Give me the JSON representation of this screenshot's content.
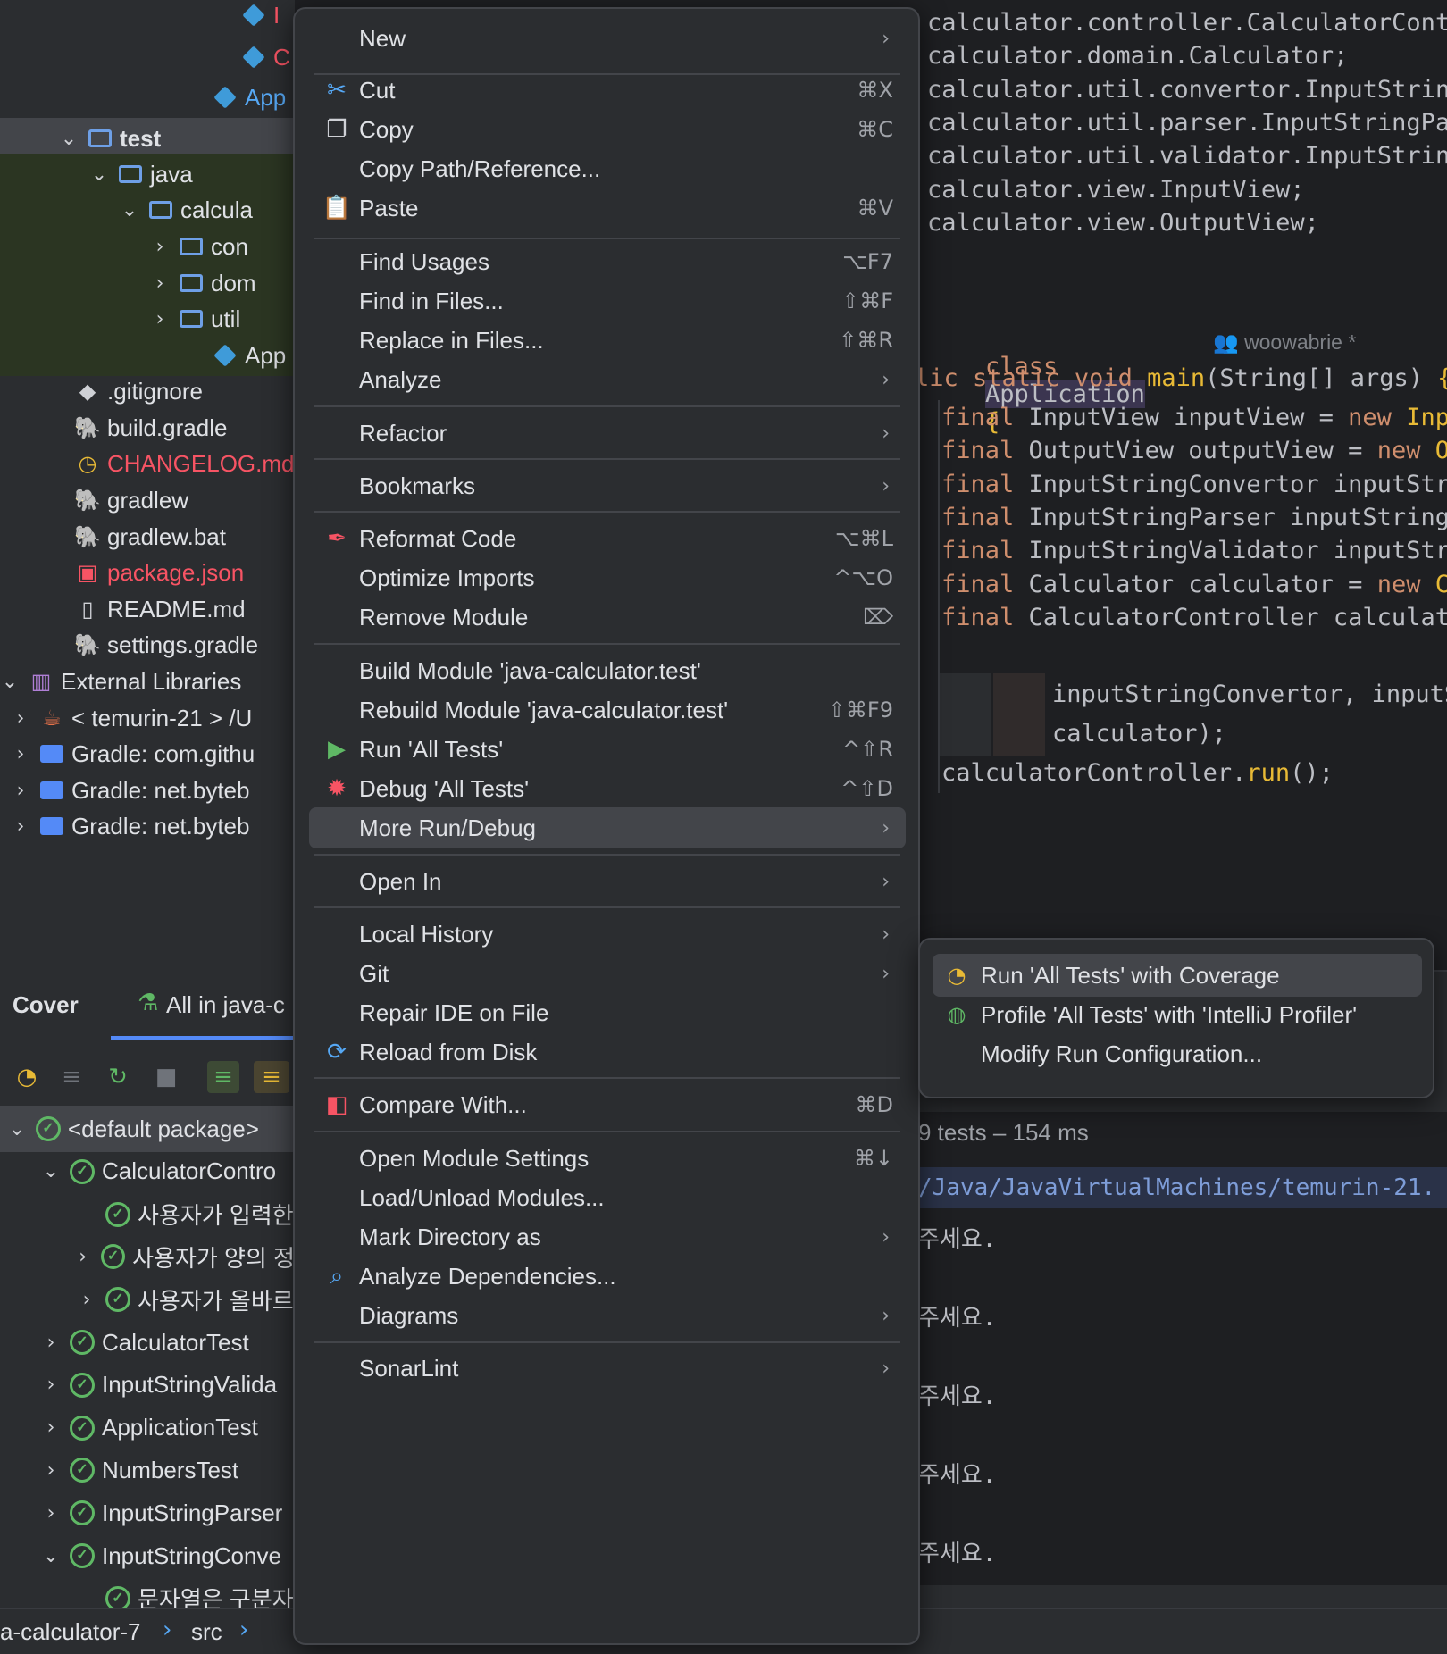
{
  "project_tree": {
    "rows": [
      {
        "label": "I",
        "kind": "cube",
        "color": "#f75464"
      },
      {
        "label": "C",
        "kind": "cube",
        "color": "#f75464"
      },
      {
        "label": "App",
        "kind": "cube-app",
        "color": "#56a8f5"
      },
      {
        "label": "test",
        "kind": "folder-test",
        "color": "#dfe1e5"
      },
      {
        "label": "java",
        "kind": "folder-src",
        "color": "#dfe1e5"
      },
      {
        "label": "calcula",
        "kind": "folder",
        "color": "#dfe1e5"
      },
      {
        "label": "con",
        "kind": "folder-pkg",
        "color": "#dfe1e5"
      },
      {
        "label": "dom",
        "kind": "folder-pkg",
        "color": "#dfe1e5"
      },
      {
        "label": "util",
        "kind": "folder-pkg",
        "color": "#dfe1e5"
      },
      {
        "label": "App",
        "kind": "cube-app",
        "color": "#dfe1e5"
      },
      {
        "label": ".gitignore",
        "kind": "git",
        "color": "#dfe1e5"
      },
      {
        "label": "build.gradle",
        "kind": "gradle",
        "color": "#dfe1e5"
      },
      {
        "label": "CHANGELOG.md",
        "kind": "clock",
        "color": "#f75464"
      },
      {
        "label": "gradlew",
        "kind": "gradle-purple",
        "color": "#dfe1e5"
      },
      {
        "label": "gradlew.bat",
        "kind": "gradle-purple",
        "color": "#dfe1e5"
      },
      {
        "label": "package.json",
        "kind": "npm",
        "color": "#f75464"
      },
      {
        "label": "README.md",
        "kind": "book",
        "color": "#dfe1e5"
      },
      {
        "label": "settings.gradle",
        "kind": "gradle",
        "color": "#dfe1e5"
      },
      {
        "label": "External Libraries",
        "kind": "libs",
        "color": "#dfe1e5"
      },
      {
        "label": "< temurin-21 > /U",
        "kind": "java",
        "color": "#dfe1e5"
      },
      {
        "label": "Gradle: com.githu",
        "kind": "lib-folder",
        "color": "#dfe1e5"
      },
      {
        "label": "Gradle: net.byteb",
        "kind": "lib-folder",
        "color": "#dfe1e5"
      },
      {
        "label": "Gradle: net.byteb",
        "kind": "lib-folder",
        "color": "#dfe1e5"
      }
    ]
  },
  "editor": {
    "imports": [
      "calculator.controller.CalculatorContro",
      "calculator.domain.Calculator;",
      "calculator.util.convertor.InputString",
      "calculator.util.parser.InputStringPars",
      "calculator.util.validator.InputString",
      "calculator.view.InputView;",
      "calculator.view.OutputView;"
    ],
    "class_kw": "class",
    "class_name": "Application",
    "brace": "{",
    "author": "woowabrie *",
    "main_sig": {
      "prefix": "lic",
      "kw": "static void",
      "name": "main",
      "params": "(String[] args)",
      "brace": "{"
    },
    "body": [
      {
        "kw": "final",
        "text": "InputView inputView = ",
        "kw2": "new",
        "tail": "Input"
      },
      {
        "kw": "final",
        "text": "OutputView outputView = ",
        "kw2": "new",
        "tail": "Out"
      },
      {
        "kw": "final",
        "text": "InputStringConvertor inputStrin",
        "kw2": "",
        "tail": ""
      },
      {
        "kw": "final",
        "text": "InputStringParser inputStringPa",
        "kw2": "",
        "tail": ""
      },
      {
        "kw": "final",
        "text": "InputStringValidator inputStrin",
        "kw2": "",
        "tail": ""
      },
      {
        "kw": "final",
        "text": "Calculator calculator = ",
        "kw2": "new",
        "tail": "Ca"
      },
      {
        "kw": "final",
        "text": "CalculatorController calculato",
        "kw2": "",
        "tail": ""
      }
    ],
    "cont1": "inputStringConvertor, inputSt",
    "cont2": "calculator);",
    "run_line": {
      "obj": "calculatorController.",
      "call": "run",
      "end": "();"
    }
  },
  "bottom": {
    "tab_cover": "Cover",
    "tab_all": "All in java-c",
    "summary": "9 tests – 154 ms",
    "console_path": "/Java/JavaVirtualMachines/temurin-21.",
    "console_lines": [
      "주세요.",
      "주세요.",
      "주세요.",
      "주세요.",
      "주세요."
    ],
    "tests": [
      {
        "label": "<default package>",
        "indent": 0,
        "chev": "⌄"
      },
      {
        "label": "CalculatorContro",
        "indent": 1,
        "chev": "⌄"
      },
      {
        "label": "사용자가 입력한",
        "indent": 2,
        "chev": ""
      },
      {
        "label": "사용자가 양의 정",
        "indent": 2,
        "chev": "›"
      },
      {
        "label": "사용자가 올바르",
        "indent": 2,
        "chev": "›"
      },
      {
        "label": "CalculatorTest",
        "indent": 1,
        "chev": "›"
      },
      {
        "label": "InputStringValida",
        "indent": 1,
        "chev": "›"
      },
      {
        "label": "ApplicationTest",
        "indent": 1,
        "chev": "›"
      },
      {
        "label": "NumbersTest",
        "indent": 1,
        "chev": "›"
      },
      {
        "label": "InputStringParser",
        "indent": 1,
        "chev": "›"
      },
      {
        "label": "InputStringConve",
        "indent": 1,
        "chev": "⌄"
      },
      {
        "label": "문자열은 구분자",
        "indent": 2,
        "chev": ""
      }
    ]
  },
  "breadcrumb": {
    "project": "a-calculator-7",
    "src": "src"
  },
  "context_menu": {
    "items": [
      {
        "label": "New",
        "shortcut": "",
        "submenu": true,
        "icon": ""
      },
      {
        "label": "Cut",
        "shortcut": "⌘X",
        "submenu": false,
        "icon": "scissors-icon"
      },
      {
        "label": "Copy",
        "shortcut": "⌘C",
        "submenu": false,
        "icon": "copy-icon"
      },
      {
        "label": "Copy Path/Reference...",
        "shortcut": "",
        "submenu": false,
        "icon": ""
      },
      {
        "label": "Paste",
        "shortcut": "⌘V",
        "submenu": false,
        "icon": "clipboard-icon"
      },
      {
        "label": "Find Usages",
        "shortcut": "⌥F7",
        "submenu": false,
        "icon": ""
      },
      {
        "label": "Find in Files...",
        "shortcut": "⇧⌘F",
        "submenu": false,
        "icon": ""
      },
      {
        "label": "Replace in Files...",
        "shortcut": "⇧⌘R",
        "submenu": false,
        "icon": ""
      },
      {
        "label": "Analyze",
        "shortcut": "",
        "submenu": true,
        "icon": ""
      },
      {
        "label": "Refactor",
        "shortcut": "",
        "submenu": true,
        "icon": ""
      },
      {
        "label": "Bookmarks",
        "shortcut": "",
        "submenu": true,
        "icon": ""
      },
      {
        "label": "Reformat Code",
        "shortcut": "⌥⌘L",
        "submenu": false,
        "icon": "reformat-icon"
      },
      {
        "label": "Optimize Imports",
        "shortcut": "^⌥O",
        "submenu": false,
        "icon": ""
      },
      {
        "label": "Remove Module",
        "shortcut": "⌦",
        "submenu": false,
        "icon": ""
      },
      {
        "label": "Build Module 'java-calculator.test'",
        "shortcut": "",
        "submenu": false,
        "icon": ""
      },
      {
        "label": "Rebuild Module 'java-calculator.test'",
        "shortcut": "⇧⌘F9",
        "submenu": false,
        "icon": ""
      },
      {
        "label": "Run 'All Tests'",
        "shortcut": "^⇧R",
        "submenu": false,
        "icon": "run-icon"
      },
      {
        "label": "Debug 'All Tests'",
        "shortcut": "^⇧D",
        "submenu": false,
        "icon": "debug-icon"
      },
      {
        "label": "More Run/Debug",
        "shortcut": "",
        "submenu": true,
        "icon": ""
      },
      {
        "label": "Open In",
        "shortcut": "",
        "submenu": true,
        "icon": ""
      },
      {
        "label": "Local History",
        "shortcut": "",
        "submenu": true,
        "icon": ""
      },
      {
        "label": "Git",
        "shortcut": "",
        "submenu": true,
        "icon": ""
      },
      {
        "label": "Repair IDE on File",
        "shortcut": "",
        "submenu": false,
        "icon": ""
      },
      {
        "label": "Reload from Disk",
        "shortcut": "",
        "submenu": false,
        "icon": "reload-icon"
      },
      {
        "label": "Compare With...",
        "shortcut": "⌘D",
        "submenu": false,
        "icon": "compare-icon"
      },
      {
        "label": "Open Module Settings",
        "shortcut": "⌘↓",
        "submenu": false,
        "icon": ""
      },
      {
        "label": "Load/Unload Modules...",
        "shortcut": "",
        "submenu": false,
        "icon": ""
      },
      {
        "label": "Mark Directory as",
        "shortcut": "",
        "submenu": true,
        "icon": ""
      },
      {
        "label": "Analyze Dependencies...",
        "shortcut": "",
        "submenu": false,
        "icon": "analyze-deps-icon"
      },
      {
        "label": "Diagrams",
        "shortcut": "",
        "submenu": true,
        "icon": ""
      },
      {
        "label": "SonarLint",
        "shortcut": "",
        "submenu": true,
        "icon": ""
      }
    ],
    "highlighted": "More Run/Debug"
  },
  "submenu": {
    "items": [
      {
        "label": "Run 'All Tests' with Coverage",
        "icon": "coverage-icon"
      },
      {
        "label": "Profile 'All Tests' with 'IntelliJ Profiler'",
        "icon": "profiler-icon"
      },
      {
        "label": "Modify Run Configuration...",
        "icon": ""
      }
    ]
  },
  "colors": {
    "accent": "#548af7",
    "success": "#5fb865",
    "error": "#f75464"
  }
}
